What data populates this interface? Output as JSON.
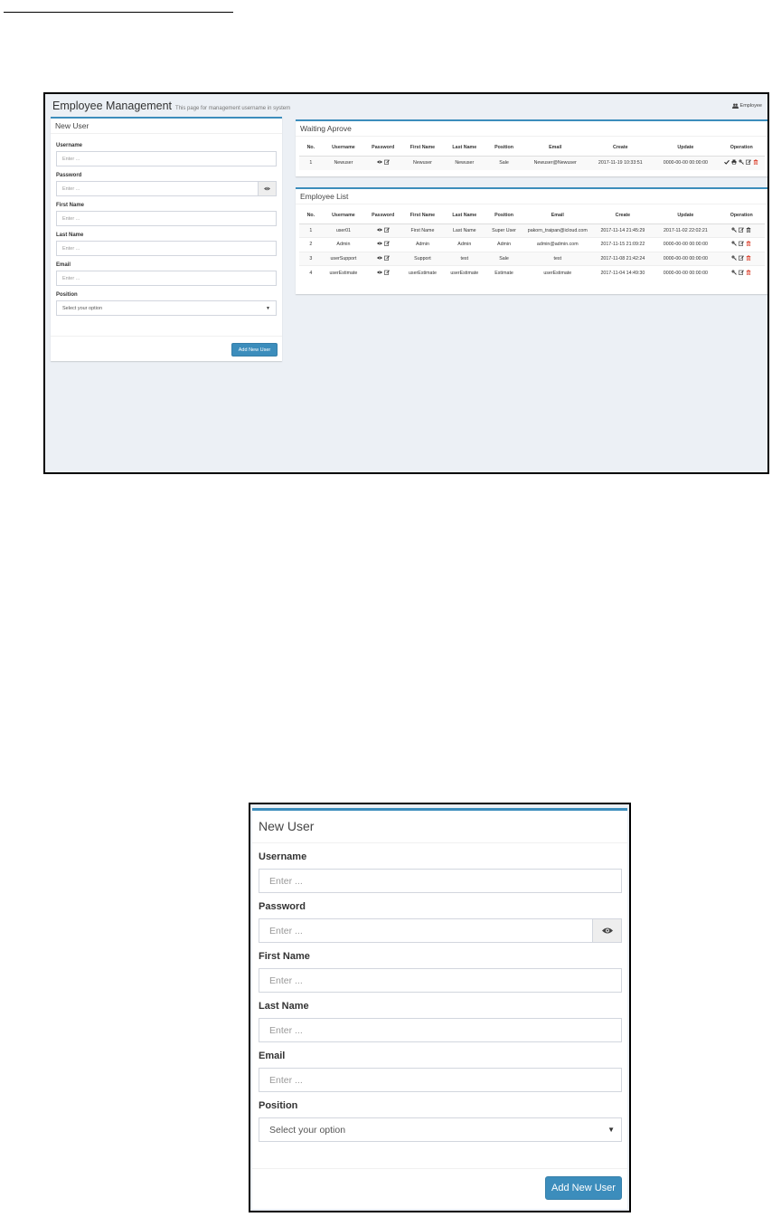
{
  "page": {
    "title": "Employee Management",
    "subtitle": "This page for management username in system",
    "breadcrumb": "Employee"
  },
  "new_user_form": {
    "title": "New User",
    "fields": {
      "username": {
        "label": "Username",
        "placeholder": "Enter ..."
      },
      "password": {
        "label": "Password",
        "placeholder": "Enter ..."
      },
      "first_name": {
        "label": "First Name",
        "placeholder": "Enter ..."
      },
      "last_name": {
        "label": "Last Name",
        "placeholder": "Enter ..."
      },
      "email": {
        "label": "Email",
        "placeholder": "Enter ..."
      },
      "position": {
        "label": "Position",
        "selected": "Select your option"
      }
    },
    "submit_label": "Add New User"
  },
  "columns": [
    "No.",
    "Username",
    "Password",
    "First Name",
    "Last Name",
    "Position",
    "Email",
    "Create",
    "Update",
    "Operation"
  ],
  "waiting_approve": {
    "title": "Waiting Aprove",
    "rows": [
      {
        "no": "1",
        "username": "Newuser",
        "first_name": "Newuser",
        "last_name": "Newuser",
        "position": "Sale",
        "email": "Newuser@Newuser",
        "create": "2017-11-19 10:33:51",
        "update": "0000-00-00 00:00:00"
      }
    ]
  },
  "employee_list": {
    "title": "Employee List",
    "rows": [
      {
        "no": "1",
        "username": "user01",
        "first_name": "First Name",
        "last_name": "Last Name",
        "position": "Super User",
        "email": "pakorn_traipan@icloud.com",
        "create": "2017-11-14 21:45:29",
        "update": "2017-11-02 22:02:21"
      },
      {
        "no": "2",
        "username": "Admin",
        "first_name": "Admin",
        "last_name": "Admin",
        "position": "Admin",
        "email": "admin@admin.com",
        "create": "2017-11-15 21:09:22",
        "update": "0000-00-00 00:00:00"
      },
      {
        "no": "3",
        "username": "userSupport",
        "first_name": "Support",
        "last_name": "test",
        "position": "Sale",
        "email": "test",
        "create": "2017-11-08 21:42:24",
        "update": "0000-00-00 00:00:00"
      },
      {
        "no": "4",
        "username": "userEstimate",
        "first_name": "userEstimate",
        "last_name": "userEstimate",
        "position": "Estimate",
        "email": "userEstimate",
        "create": "2017-11-04 14:49:30",
        "update": "0000-00-00 00:00:00"
      }
    ]
  },
  "colors": {
    "primary": "#3c8dbc",
    "danger": "#dd4b39",
    "background": "#ecf0f5"
  },
  "icons": [
    "users-icon",
    "eye-icon",
    "edit-icon",
    "check-icon",
    "print-icon",
    "key-icon",
    "trash-icon",
    "caret-down-icon"
  ]
}
